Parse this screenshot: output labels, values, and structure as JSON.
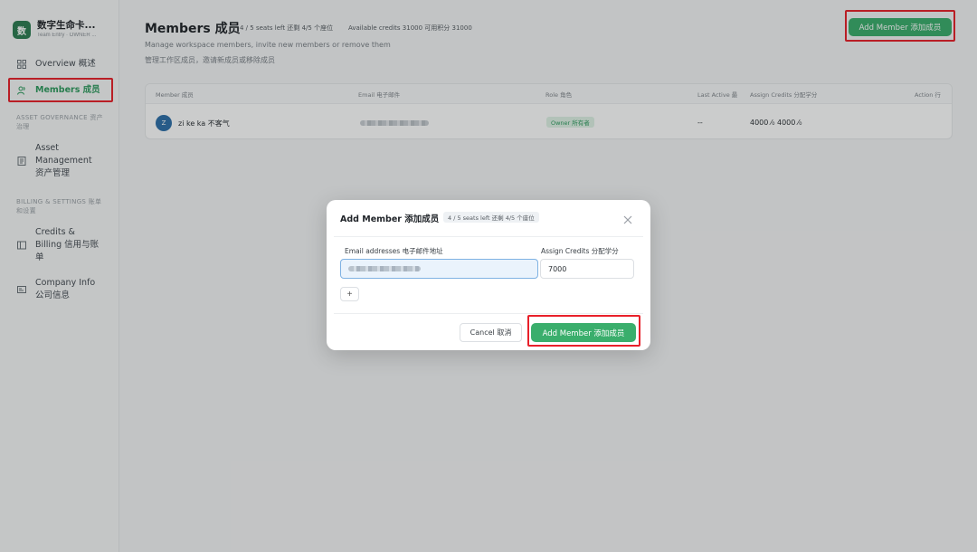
{
  "sidebar": {
    "brand_logo": "数",
    "brand_name": "数字生命卡...",
    "brand_sub": "Team Entry · OWNER ...",
    "items": [
      {
        "label": "Overview 概述",
        "icon": "grid-icon"
      },
      {
        "label": "Members 成员",
        "icon": "users-icon"
      },
      {
        "label": "Asset Management 资产管理",
        "icon": "document-icon"
      },
      {
        "label": "Credits & Billing 信用与账单",
        "icon": "billing-icon"
      },
      {
        "label": "Company Info 公司信息",
        "icon": "id-card-icon"
      }
    ],
    "sections": [
      {
        "label": "ASSET GOVERNANCE 资产治理"
      },
      {
        "label": "BILLING & SETTINGS 账单和设置"
      }
    ]
  },
  "header": {
    "title": "Members 成员",
    "seats": "4 / 5 seats left 还剩 4/5 个座位",
    "credits": "Available credits 31000 可用积分 31000",
    "desc_en": "Manage workspace members, invite new members or remove them",
    "desc_zh": "管理工作区成员，邀请新成员或移除成员",
    "add_button": "Add Member 添加成员"
  },
  "table": {
    "columns": [
      "Member 成员",
      "Email 电子邮件",
      "Role 角色",
      "Last Active 最",
      "Assign Credits 分配学分",
      "Action 行"
    ],
    "rows": [
      {
        "avatar": "Z",
        "name": "zi ke ka 不客气",
        "role": "Owner 所有者",
        "last_active": "--",
        "credits": "4000 ⁄₀ 4000 ⁄₀"
      }
    ]
  },
  "modal": {
    "title": "Add Member 添加成员",
    "badge": "4 / 5 seats left 还剩 4/5 个座位",
    "email_label": "Email addresses 电子邮件地址",
    "credits_label": "Assign Credits 分配学分",
    "credits_value": "7000",
    "add_row": "+",
    "cancel": "Cancel 取消",
    "submit": "Add Member 添加成员"
  },
  "colors": {
    "accent": "#3aae6c",
    "highlight": "#e8202a",
    "avatar": "#2d6fa8"
  }
}
